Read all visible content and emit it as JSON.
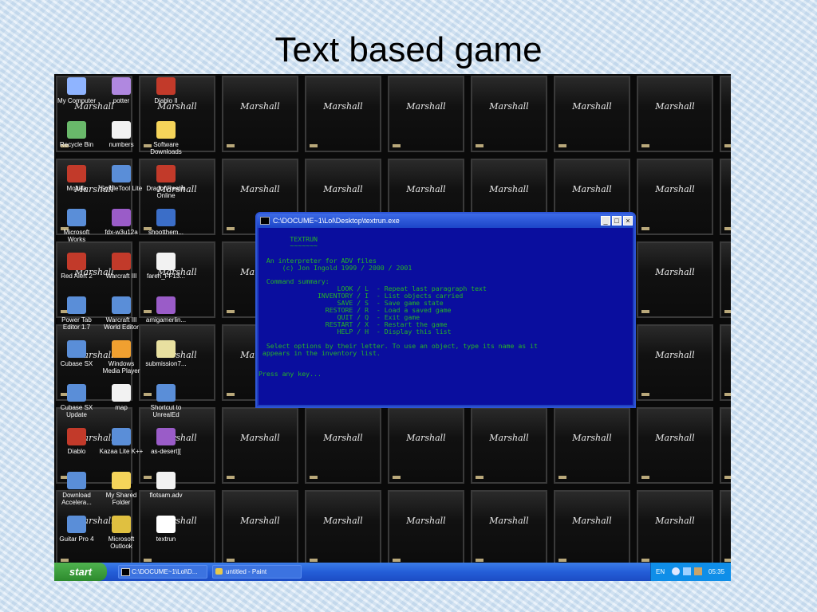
{
  "slide": {
    "title": "Text based game"
  },
  "amp": {
    "logo": "Marshall"
  },
  "desktop_icons": [
    {
      "label": "My Computer",
      "icon": "computer-icon"
    },
    {
      "label": "potter",
      "icon": "shortcut-icon"
    },
    {
      "label": "Diablo II",
      "icon": "game-icon"
    },
    {
      "label": "Recycle Bin",
      "icon": "recycle-bin-icon"
    },
    {
      "label": "numbers",
      "icon": "text-file-icon"
    },
    {
      "label": "Software Downloads",
      "icon": "folder-icon"
    },
    {
      "label": "Mozilla",
      "icon": "browser-icon"
    },
    {
      "label": "SmbleTool Lite",
      "icon": "app-icon"
    },
    {
      "label": "DragonRealm Online",
      "icon": "game-icon"
    },
    {
      "label": "Microsoft Works",
      "icon": "app-icon"
    },
    {
      "label": "fdx-w3u12a",
      "icon": "archive-icon"
    },
    {
      "label": "shootthem...",
      "icon": "spam-icon"
    },
    {
      "label": "Red Alert 2",
      "icon": "game-icon"
    },
    {
      "label": "Warcraft III",
      "icon": "game-icon"
    },
    {
      "label": "fareri_FF13...",
      "icon": "text-file-icon"
    },
    {
      "label": "Power Tab Editor 1.7",
      "icon": "app-icon"
    },
    {
      "label": "Warcraft III World Editor",
      "icon": "app-icon"
    },
    {
      "label": "amigamerlin...",
      "icon": "archive-icon"
    },
    {
      "label": "Cubase SX",
      "icon": "app-icon"
    },
    {
      "label": "Windows Media Player",
      "icon": "media-player-icon"
    },
    {
      "label": "submission7...",
      "icon": "image-file-icon"
    },
    {
      "label": "Cubase SX Update",
      "icon": "app-icon"
    },
    {
      "label": "map",
      "icon": "text-file-icon"
    },
    {
      "label": "Shortcut to UnrealEd",
      "icon": "app-icon"
    },
    {
      "label": "Diablo",
      "icon": "game-icon"
    },
    {
      "label": "Kazaa Lite K++",
      "icon": "app-icon"
    },
    {
      "label": "as-desert][",
      "icon": "archive-icon"
    },
    {
      "label": "Download Accelera...",
      "icon": "app-icon"
    },
    {
      "label": "My Shared Folder",
      "icon": "folder-icon"
    },
    {
      "label": "flotsam.adv",
      "icon": "text-file-icon"
    },
    {
      "label": "Guitar Pro 4",
      "icon": "app-icon"
    },
    {
      "label": "Microsoft Outlook",
      "icon": "mail-icon"
    },
    {
      "label": "textrun",
      "icon": "console-icon"
    }
  ],
  "console": {
    "title": "C:\\DOCUME~1\\Lol\\Desktop\\textrun.exe",
    "minimize": "_",
    "maximize": "□",
    "close": "×",
    "lines": [
      "        TEXTRUN",
      "        ~~~~~~~",
      "  An interpreter for ADV files",
      "      (c) Jon Ingold 1999 / 2000 / 2001",
      "  Command summary:",
      "                    LOOK / L  - Repeat last paragraph text",
      "               INVENTORY / I  - List objects carried",
      "                    SAVE / S  - Save game state",
      "                 RESTORE / R  - Load a saved game",
      "                    QUIT / Q  - Exit game",
      "                 RESTART / X  - Restart the game",
      "                    HELP / H  - Display this list",
      "  Select options by their letter. To use an object, type its name as it",
      " appears in the inventory list.",
      "Press any key..."
    ]
  },
  "taskbar": {
    "start": "start",
    "buttons": [
      {
        "label": "C:\\DOCUME~1\\Lol\\D...",
        "icon": "console-icon"
      },
      {
        "label": "untitled - Paint",
        "icon": "paint-icon"
      }
    ],
    "language": "EN",
    "clock": "05:35"
  }
}
